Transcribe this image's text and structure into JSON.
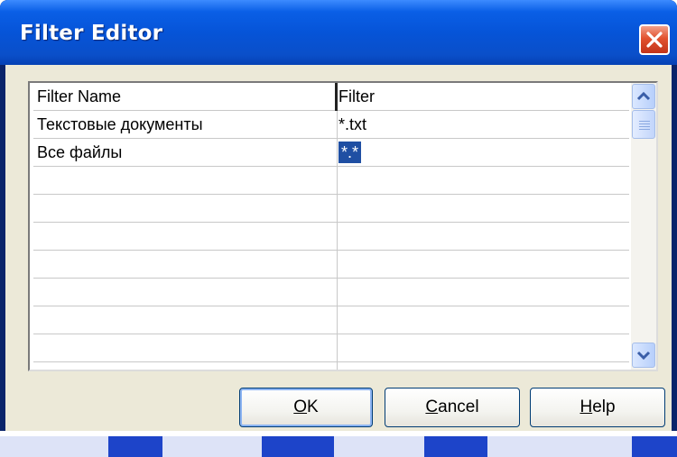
{
  "window": {
    "title": "Filter Editor"
  },
  "grid": {
    "columns": [
      "Filter Name",
      "Filter"
    ],
    "rows": [
      {
        "name": "Текстовые документы",
        "filter": "*.txt"
      },
      {
        "name": "Все файлы",
        "filter": "*.*",
        "selected": true
      },
      {
        "name": "",
        "filter": ""
      },
      {
        "name": "",
        "filter": ""
      },
      {
        "name": "",
        "filter": ""
      },
      {
        "name": "",
        "filter": ""
      },
      {
        "name": "",
        "filter": ""
      },
      {
        "name": "",
        "filter": ""
      },
      {
        "name": "",
        "filter": ""
      }
    ]
  },
  "buttons": {
    "ok": {
      "underline": "O",
      "rest": "K"
    },
    "cancel": {
      "underline": "C",
      "rest": "ancel"
    },
    "help": {
      "underline": "H",
      "rest": "elp"
    }
  },
  "colors": {
    "titlebar": "#0654d8",
    "selection": "#1f4fa3",
    "dialog_bg": "#ece9d8",
    "close_button": "#e2522f"
  },
  "icons": {
    "close": "close-x-icon",
    "scroll_up": "chevron-up-icon",
    "scroll_down": "chevron-down-icon"
  }
}
